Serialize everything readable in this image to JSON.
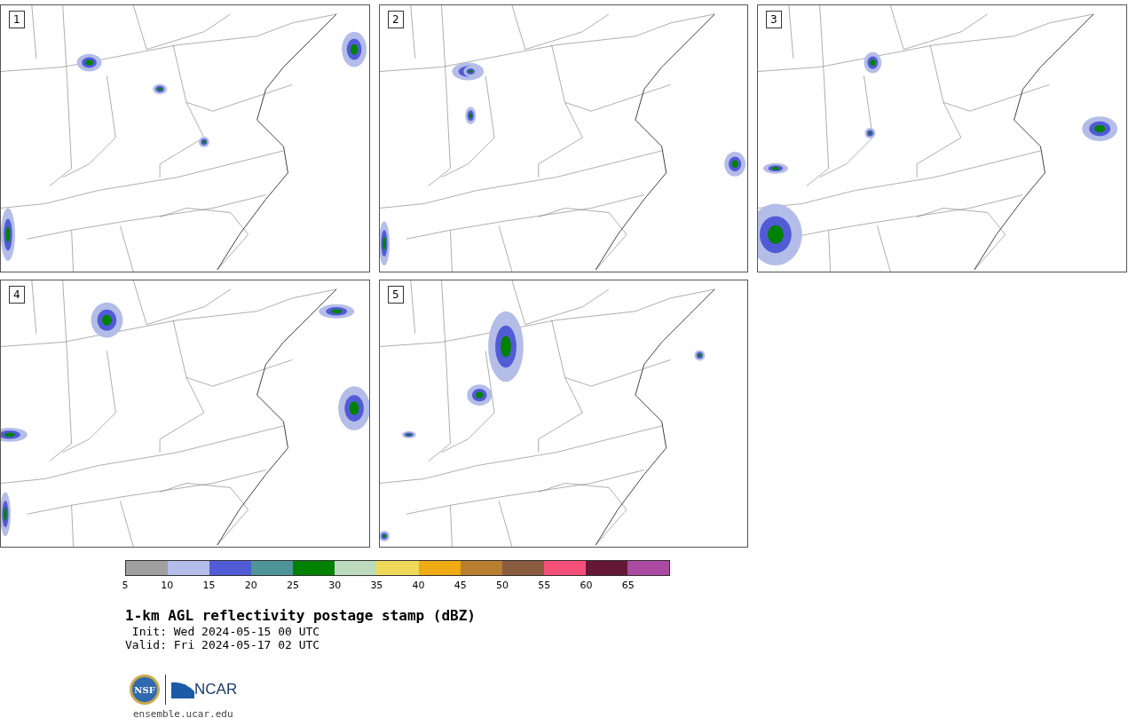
{
  "panels": [
    {
      "label": "1"
    },
    {
      "label": "2"
    },
    {
      "label": "3"
    },
    {
      "label": "4"
    },
    {
      "label": "5"
    }
  ],
  "legend": {
    "bins": [
      {
        "color": "#a0a0a0"
      },
      {
        "color": "#b4bde8"
      },
      {
        "color": "#525bd6"
      },
      {
        "color": "#4f9598"
      },
      {
        "color": "#008100"
      },
      {
        "color": "#bcdabc"
      },
      {
        "color": "#eed85a"
      },
      {
        "color": "#eeab14"
      },
      {
        "color": "#b87f31"
      },
      {
        "color": "#8a5b3f"
      },
      {
        "color": "#f5507a"
      },
      {
        "color": "#641834"
      },
      {
        "color": "#aa4aa0"
      }
    ],
    "ticks": [
      "5",
      "10",
      "15",
      "20",
      "25",
      "30",
      "35",
      "40",
      "45",
      "50",
      "55",
      "60",
      "65"
    ]
  },
  "title": "1-km AGL reflectivity postage stamp (dBZ)",
  "init": " Init: Wed 2024-05-15 00 UTC",
  "valid": "Valid: Fri 2024-05-17 02 UTC",
  "logo": {
    "text": "NCAR",
    "seal": "NSF"
  },
  "url": "ensemble.ucar.edu"
}
